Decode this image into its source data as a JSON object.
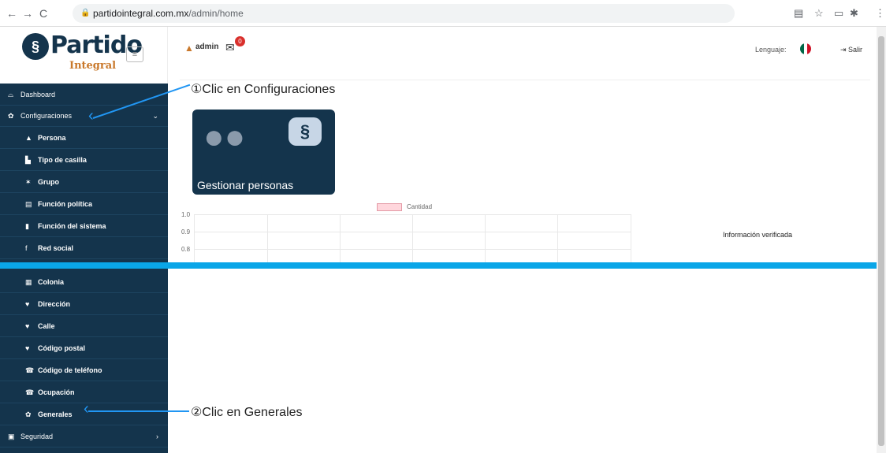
{
  "browser": {
    "url_host": "partidointegral.com.mx",
    "url_path": "/admin/home"
  },
  "logo": {
    "title": "Partido",
    "subtitle": "Integral"
  },
  "sidebar": {
    "items": [
      {
        "label": "Dashboard",
        "icon": "dashboard-icon",
        "glyph": "⌓"
      },
      {
        "label": "Configuraciones",
        "icon": "gear-icon",
        "glyph": "✿"
      },
      {
        "label": "Persona",
        "icon": "user-icon",
        "glyph": "▲"
      },
      {
        "label": "Tipo de casilla",
        "icon": "file-icon",
        "glyph": "▙"
      },
      {
        "label": "Grupo",
        "icon": "group-icon",
        "glyph": "✶"
      },
      {
        "label": "Función política",
        "icon": "edit-icon",
        "glyph": "▤"
      },
      {
        "label": "Función del sistema",
        "icon": "bookmark-icon",
        "glyph": "▮"
      },
      {
        "label": "Red social",
        "icon": "facebook-icon",
        "glyph": "f"
      },
      {
        "label": "Colonia",
        "icon": "map-icon",
        "glyph": "▦"
      },
      {
        "label": "Dirección",
        "icon": "location-pin-icon",
        "glyph": "♥"
      },
      {
        "label": "Calle",
        "icon": "location-pin-icon",
        "glyph": "♥"
      },
      {
        "label": "Código postal",
        "icon": "location-pin-icon",
        "glyph": "♥"
      },
      {
        "label": "Código de teléfono",
        "icon": "phone-icon",
        "glyph": "☎"
      },
      {
        "label": "Ocupación",
        "icon": "phone-icon",
        "glyph": "☎"
      },
      {
        "label": "Generales",
        "icon": "gear-icon",
        "glyph": "✿"
      },
      {
        "label": "Seguridad",
        "icon": "lock-icon",
        "glyph": "▣"
      }
    ]
  },
  "topbar": {
    "user": "admin",
    "mail_count": "0",
    "language_label": "Lenguaje:",
    "logout_label": "Salir",
    "flag_colors": [
      "#006847",
      "#ffffff",
      "#ce1126"
    ]
  },
  "annotations": {
    "step1": "①Clic en Configuraciones",
    "step2": "②Clic en Generales"
  },
  "card": {
    "label": "Gestionar personas"
  },
  "chart_data": {
    "type": "bar",
    "legend": [
      "Cantidad"
    ],
    "yticks": [
      "1.0",
      "0.9",
      "0.8"
    ],
    "series": [
      {
        "name": "Cantidad",
        "values": []
      }
    ]
  },
  "side_text": "Información verificada",
  "colors": {
    "sidebar": "#14344c",
    "accent": "#2196f3",
    "separator": "#0aa6e8"
  }
}
